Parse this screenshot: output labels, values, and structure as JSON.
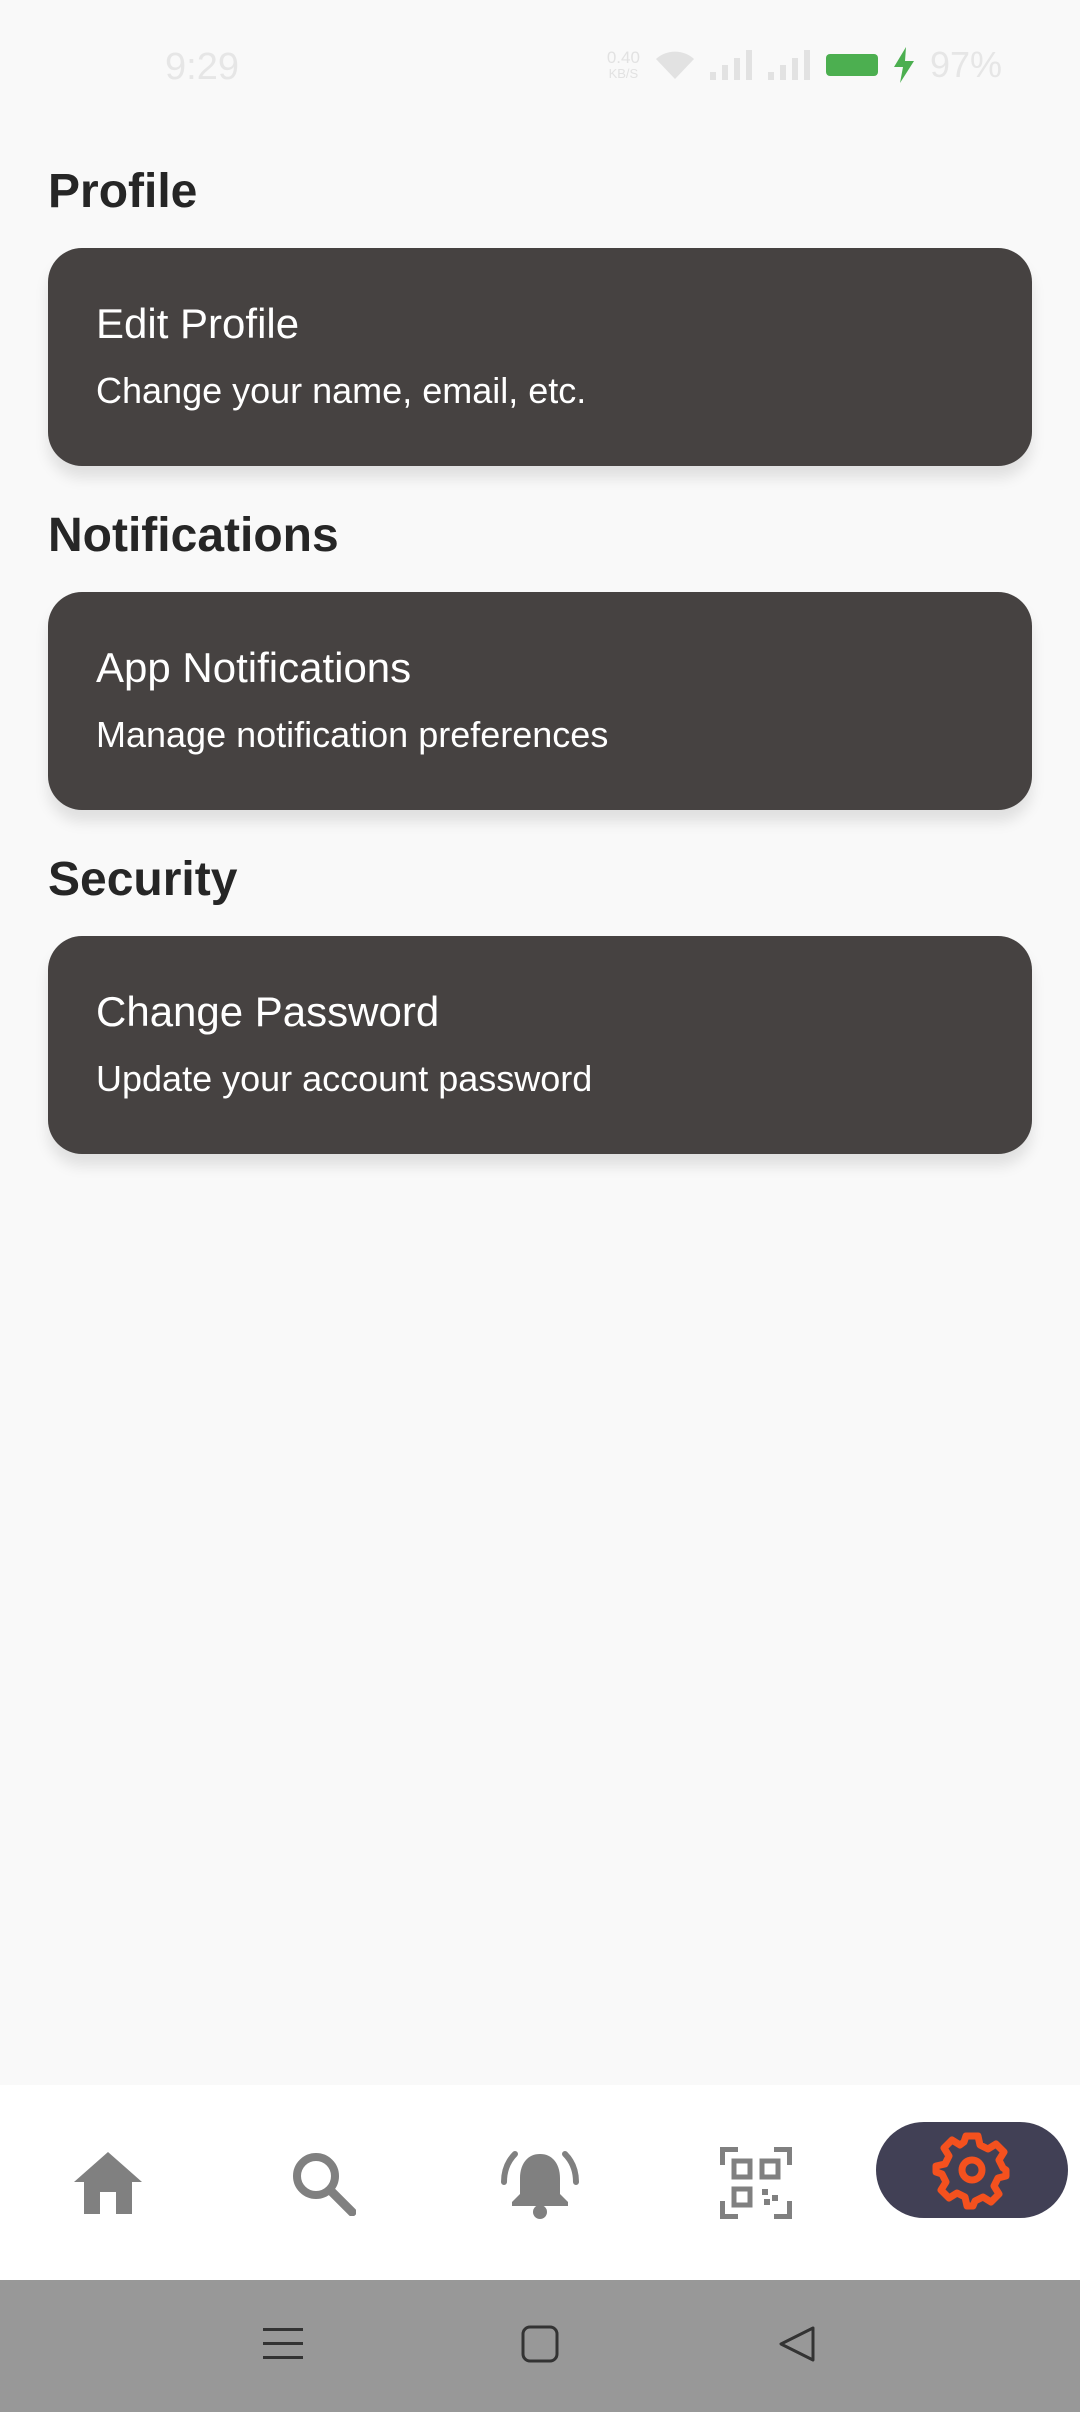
{
  "status_bar": {
    "time": "9:29",
    "net_speed_value": "0.40",
    "net_speed_unit": "KB/S",
    "battery_percent": "97%",
    "battery_color": "#4caf50"
  },
  "sections": [
    {
      "title": "Profile",
      "card": {
        "title": "Edit Profile",
        "subtitle": "Change your name, email, etc."
      }
    },
    {
      "title": "Notifications",
      "card": {
        "title": "App Notifications",
        "subtitle": "Manage notification preferences"
      }
    },
    {
      "title": "Security",
      "card": {
        "title": "Change Password",
        "subtitle": "Update your account password"
      }
    }
  ],
  "bottom_nav": {
    "items": [
      {
        "icon": "home-icon",
        "active": false
      },
      {
        "icon": "search-icon",
        "active": false
      },
      {
        "icon": "bell-icon",
        "active": false
      },
      {
        "icon": "qr-code-icon",
        "active": false
      },
      {
        "icon": "gear-icon",
        "active": true
      }
    ],
    "inactive_color": "#808080",
    "active_color": "#f4511e",
    "active_pill_color": "#414055"
  },
  "system_nav": {
    "items": [
      "menu-icon",
      "home-square-icon",
      "back-triangle-icon"
    ]
  }
}
